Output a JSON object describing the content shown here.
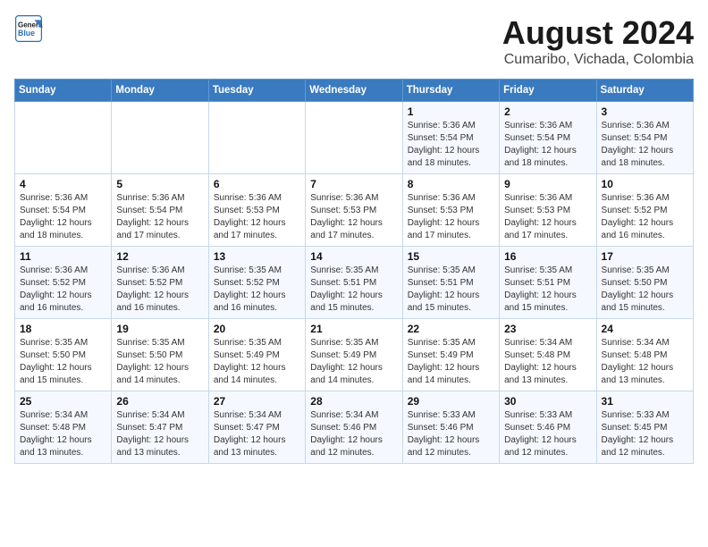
{
  "header": {
    "logo_line1": "General",
    "logo_line2": "Blue",
    "title": "August 2024",
    "subtitle": "Cumaribo, Vichada, Colombia"
  },
  "weekdays": [
    "Sunday",
    "Monday",
    "Tuesday",
    "Wednesday",
    "Thursday",
    "Friday",
    "Saturday"
  ],
  "weeks": [
    [
      {
        "day": "",
        "info": ""
      },
      {
        "day": "",
        "info": ""
      },
      {
        "day": "",
        "info": ""
      },
      {
        "day": "",
        "info": ""
      },
      {
        "day": "1",
        "info": "Sunrise: 5:36 AM\nSunset: 5:54 PM\nDaylight: 12 hours\nand 18 minutes."
      },
      {
        "day": "2",
        "info": "Sunrise: 5:36 AM\nSunset: 5:54 PM\nDaylight: 12 hours\nand 18 minutes."
      },
      {
        "day": "3",
        "info": "Sunrise: 5:36 AM\nSunset: 5:54 PM\nDaylight: 12 hours\nand 18 minutes."
      }
    ],
    [
      {
        "day": "4",
        "info": "Sunrise: 5:36 AM\nSunset: 5:54 PM\nDaylight: 12 hours\nand 18 minutes."
      },
      {
        "day": "5",
        "info": "Sunrise: 5:36 AM\nSunset: 5:54 PM\nDaylight: 12 hours\nand 17 minutes."
      },
      {
        "day": "6",
        "info": "Sunrise: 5:36 AM\nSunset: 5:53 PM\nDaylight: 12 hours\nand 17 minutes."
      },
      {
        "day": "7",
        "info": "Sunrise: 5:36 AM\nSunset: 5:53 PM\nDaylight: 12 hours\nand 17 minutes."
      },
      {
        "day": "8",
        "info": "Sunrise: 5:36 AM\nSunset: 5:53 PM\nDaylight: 12 hours\nand 17 minutes."
      },
      {
        "day": "9",
        "info": "Sunrise: 5:36 AM\nSunset: 5:53 PM\nDaylight: 12 hours\nand 17 minutes."
      },
      {
        "day": "10",
        "info": "Sunrise: 5:36 AM\nSunset: 5:52 PM\nDaylight: 12 hours\nand 16 minutes."
      }
    ],
    [
      {
        "day": "11",
        "info": "Sunrise: 5:36 AM\nSunset: 5:52 PM\nDaylight: 12 hours\nand 16 minutes."
      },
      {
        "day": "12",
        "info": "Sunrise: 5:36 AM\nSunset: 5:52 PM\nDaylight: 12 hours\nand 16 minutes."
      },
      {
        "day": "13",
        "info": "Sunrise: 5:35 AM\nSunset: 5:52 PM\nDaylight: 12 hours\nand 16 minutes."
      },
      {
        "day": "14",
        "info": "Sunrise: 5:35 AM\nSunset: 5:51 PM\nDaylight: 12 hours\nand 15 minutes."
      },
      {
        "day": "15",
        "info": "Sunrise: 5:35 AM\nSunset: 5:51 PM\nDaylight: 12 hours\nand 15 minutes."
      },
      {
        "day": "16",
        "info": "Sunrise: 5:35 AM\nSunset: 5:51 PM\nDaylight: 12 hours\nand 15 minutes."
      },
      {
        "day": "17",
        "info": "Sunrise: 5:35 AM\nSunset: 5:50 PM\nDaylight: 12 hours\nand 15 minutes."
      }
    ],
    [
      {
        "day": "18",
        "info": "Sunrise: 5:35 AM\nSunset: 5:50 PM\nDaylight: 12 hours\nand 15 minutes."
      },
      {
        "day": "19",
        "info": "Sunrise: 5:35 AM\nSunset: 5:50 PM\nDaylight: 12 hours\nand 14 minutes."
      },
      {
        "day": "20",
        "info": "Sunrise: 5:35 AM\nSunset: 5:49 PM\nDaylight: 12 hours\nand 14 minutes."
      },
      {
        "day": "21",
        "info": "Sunrise: 5:35 AM\nSunset: 5:49 PM\nDaylight: 12 hours\nand 14 minutes."
      },
      {
        "day": "22",
        "info": "Sunrise: 5:35 AM\nSunset: 5:49 PM\nDaylight: 12 hours\nand 14 minutes."
      },
      {
        "day": "23",
        "info": "Sunrise: 5:34 AM\nSunset: 5:48 PM\nDaylight: 12 hours\nand 13 minutes."
      },
      {
        "day": "24",
        "info": "Sunrise: 5:34 AM\nSunset: 5:48 PM\nDaylight: 12 hours\nand 13 minutes."
      }
    ],
    [
      {
        "day": "25",
        "info": "Sunrise: 5:34 AM\nSunset: 5:48 PM\nDaylight: 12 hours\nand 13 minutes."
      },
      {
        "day": "26",
        "info": "Sunrise: 5:34 AM\nSunset: 5:47 PM\nDaylight: 12 hours\nand 13 minutes."
      },
      {
        "day": "27",
        "info": "Sunrise: 5:34 AM\nSunset: 5:47 PM\nDaylight: 12 hours\nand 13 minutes."
      },
      {
        "day": "28",
        "info": "Sunrise: 5:34 AM\nSunset: 5:46 PM\nDaylight: 12 hours\nand 12 minutes."
      },
      {
        "day": "29",
        "info": "Sunrise: 5:33 AM\nSunset: 5:46 PM\nDaylight: 12 hours\nand 12 minutes."
      },
      {
        "day": "30",
        "info": "Sunrise: 5:33 AM\nSunset: 5:46 PM\nDaylight: 12 hours\nand 12 minutes."
      },
      {
        "day": "31",
        "info": "Sunrise: 5:33 AM\nSunset: 5:45 PM\nDaylight: 12 hours\nand 12 minutes."
      }
    ]
  ]
}
